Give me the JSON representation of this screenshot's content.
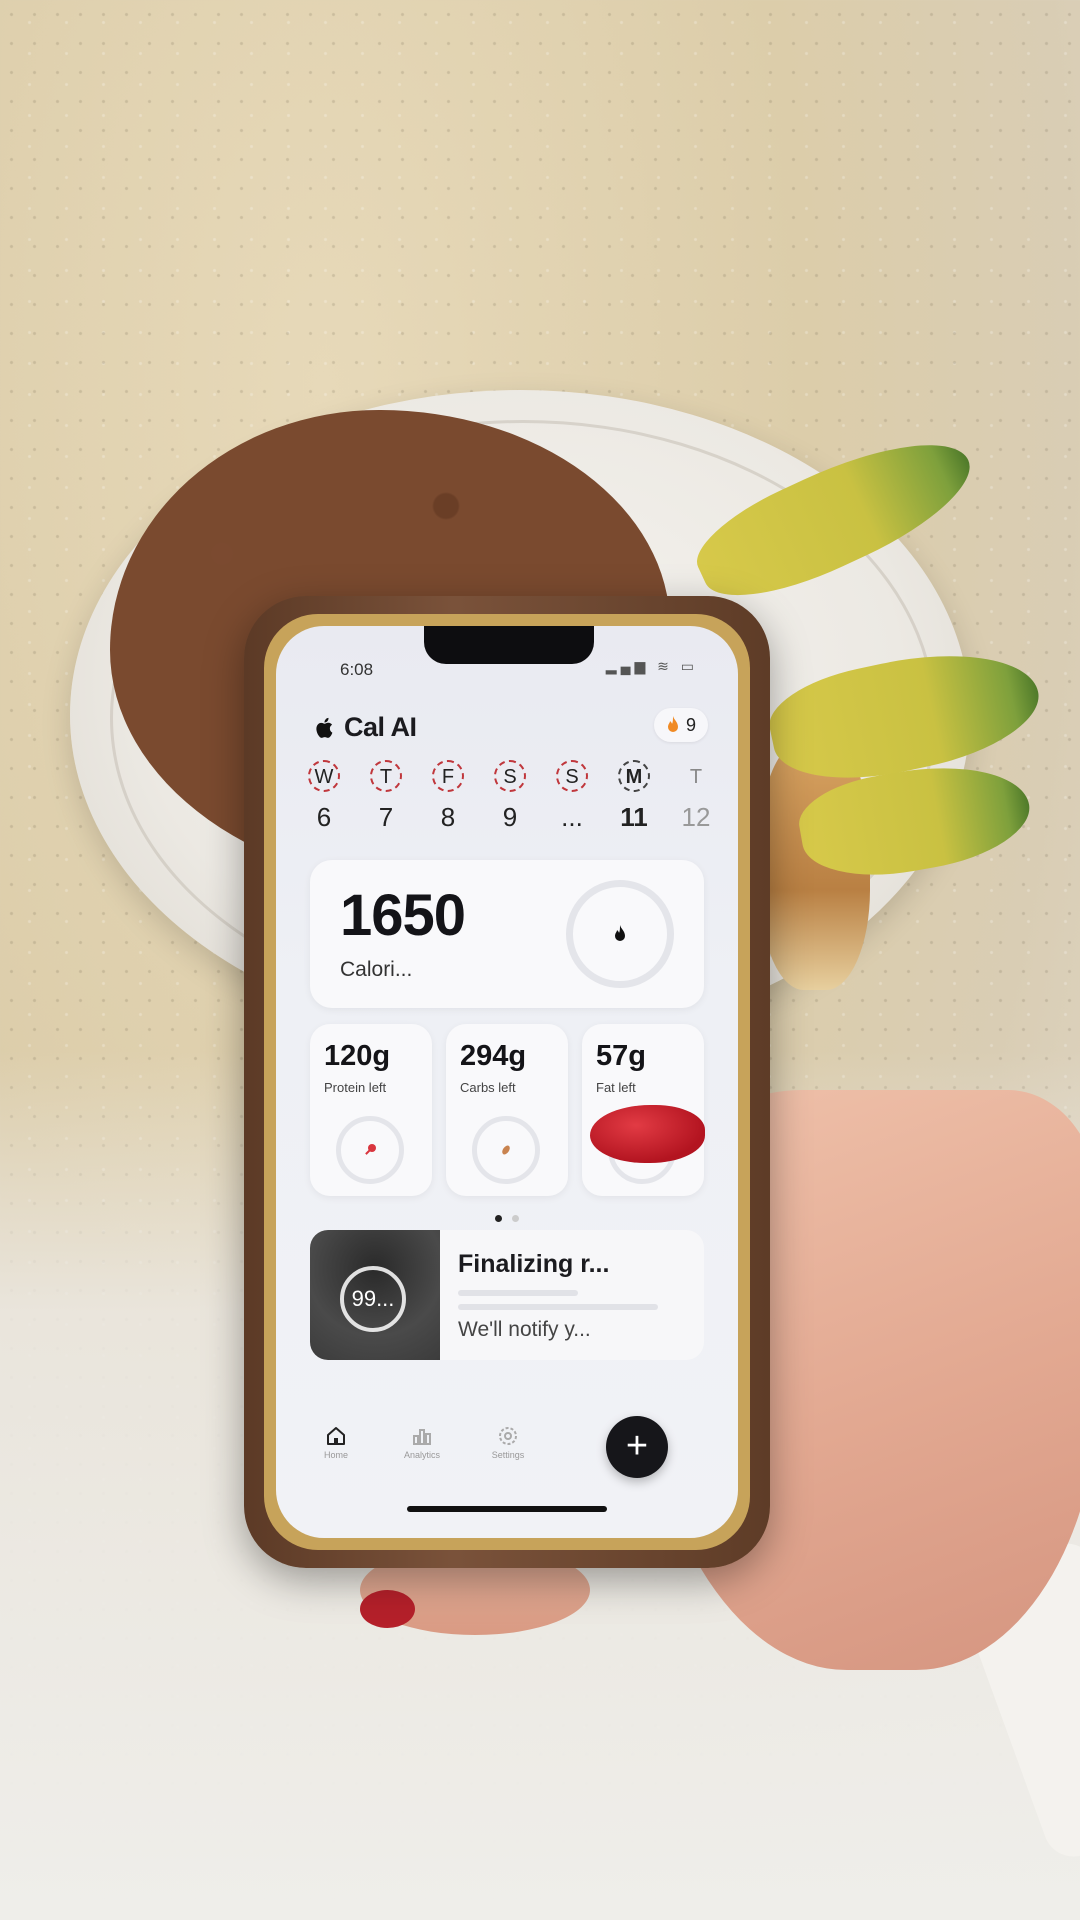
{
  "status_bar": {
    "time": "6:08",
    "icons": "▂▄▆ ≋ ▭"
  },
  "app": {
    "title": "Cal AI",
    "streak": "9"
  },
  "week": [
    {
      "letter": "W",
      "num": "6",
      "state": "past"
    },
    {
      "letter": "T",
      "num": "7",
      "state": "past"
    },
    {
      "letter": "F",
      "num": "8",
      "state": "past"
    },
    {
      "letter": "S",
      "num": "9",
      "state": "past"
    },
    {
      "letter": "S",
      "num": "...",
      "state": "past"
    },
    {
      "letter": "M",
      "num": "11",
      "state": "today"
    },
    {
      "letter": "T",
      "num": "12",
      "state": "future"
    }
  ],
  "calories": {
    "value": "1650",
    "label": "Calori..."
  },
  "macros": [
    {
      "value": "120g",
      "label": "Protein left",
      "color": "#d9363e"
    },
    {
      "value": "294g",
      "label": "Carbs left",
      "color": "#c9834f"
    },
    {
      "value": "57g",
      "label": "Fat left",
      "color": "#4e7cc4"
    }
  ],
  "scan": {
    "progress": "99...",
    "title": "Finalizing r...",
    "subtitle": "We'll notify y..."
  },
  "tabs": [
    {
      "label": "Home",
      "icon": "home-icon"
    },
    {
      "label": "Analytics",
      "icon": "analytics-icon"
    },
    {
      "label": "Settings",
      "icon": "gear-icon"
    }
  ],
  "add_button": "+"
}
